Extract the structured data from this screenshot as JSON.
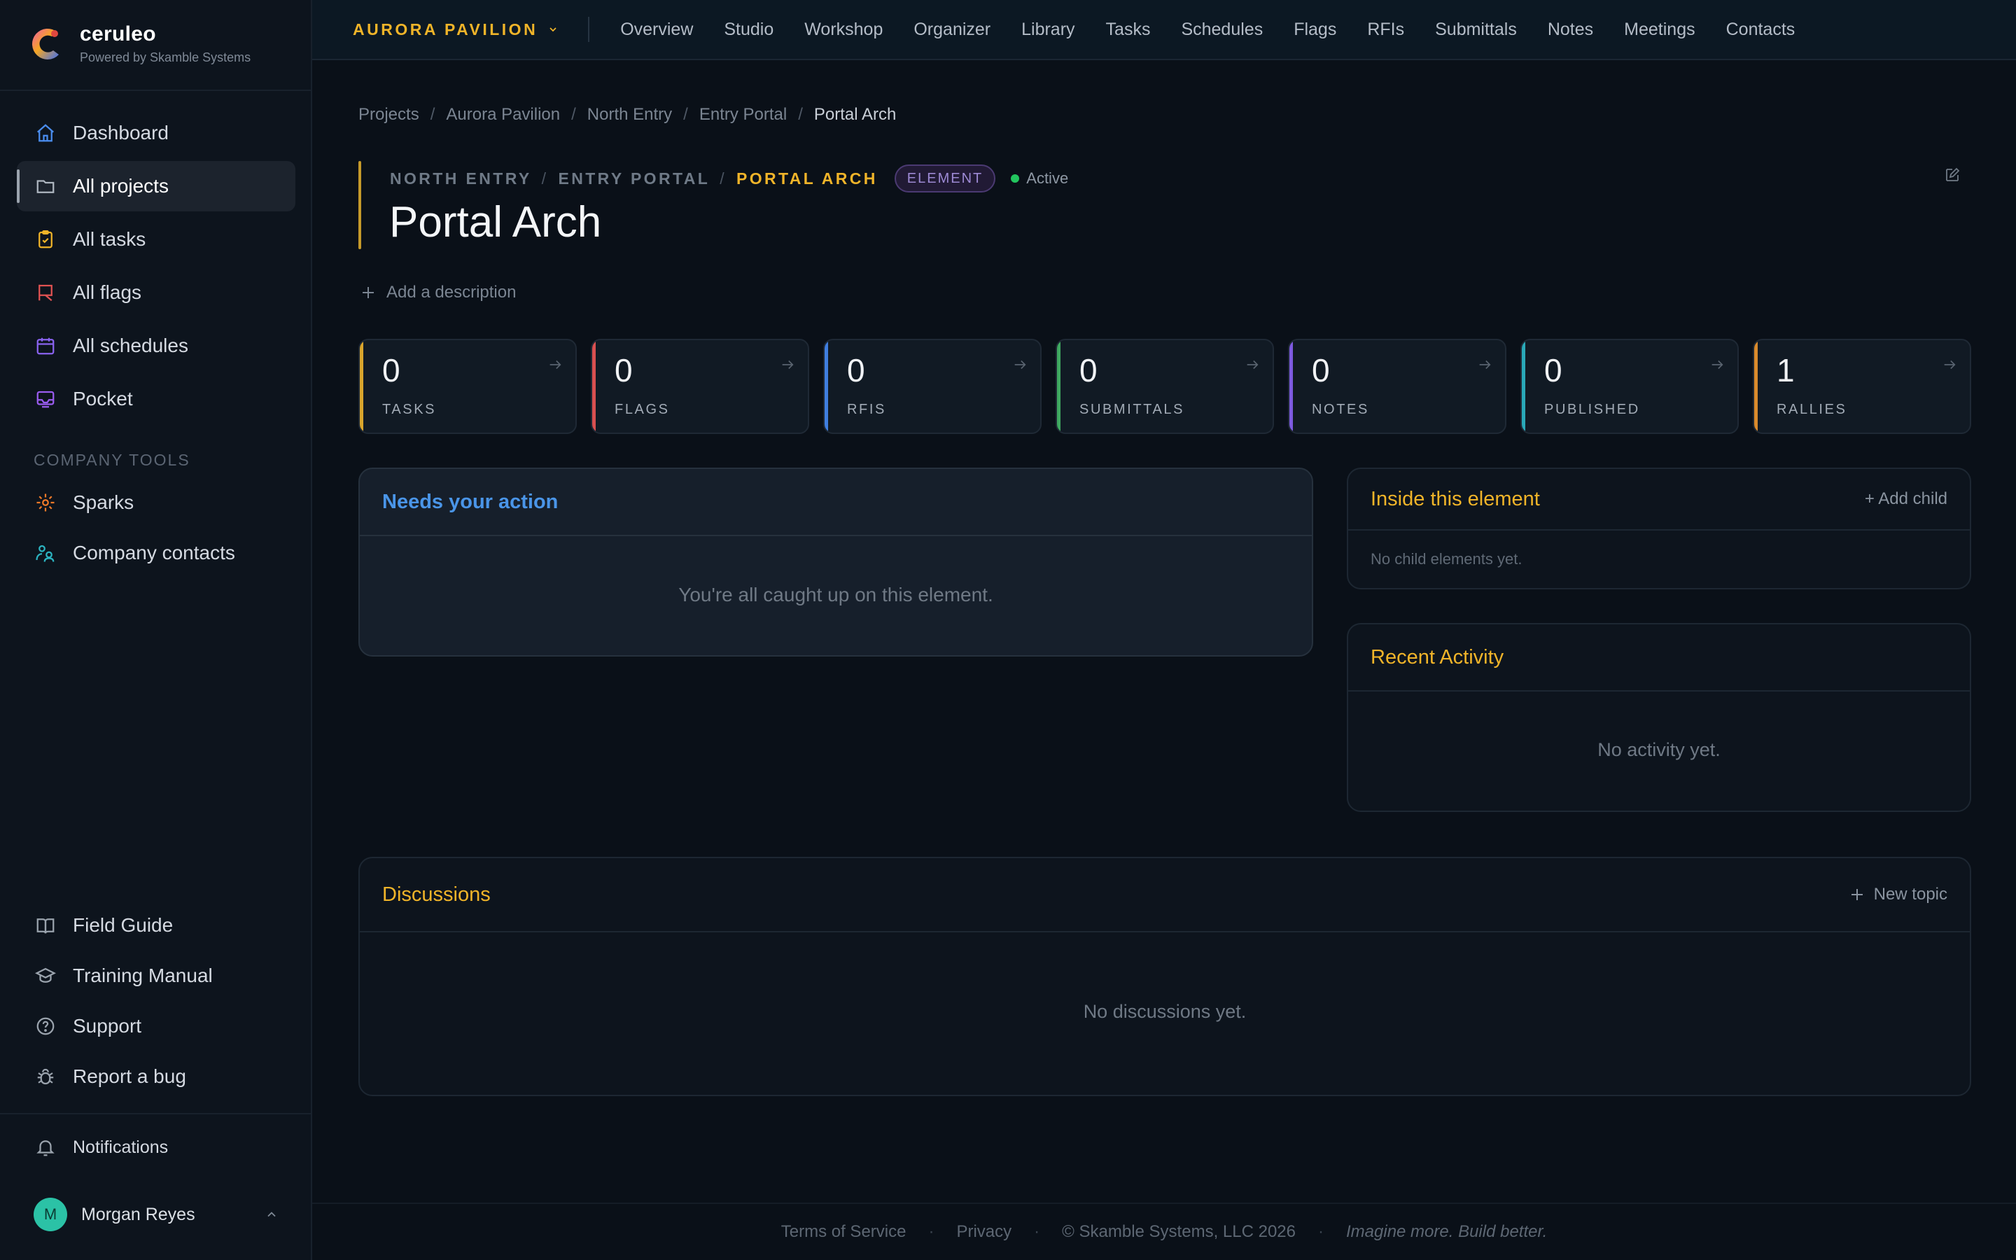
{
  "brand": {
    "name": "ceruleo",
    "subtitle": "Powered by Skamble Systems"
  },
  "sidebar": {
    "nav": [
      {
        "label": "Dashboard",
        "icon": "home-icon",
        "color": "#4a8df0"
      },
      {
        "label": "All projects",
        "icon": "folder-icon",
        "color": "#aeb6c0",
        "active": true
      },
      {
        "label": "All tasks",
        "icon": "clipboard-check-icon",
        "color": "#f0b429"
      },
      {
        "label": "All flags",
        "icon": "flag-icon",
        "color": "#e05252"
      },
      {
        "label": "All schedules",
        "icon": "calendar-icon",
        "color": "#8a63f0"
      },
      {
        "label": "Pocket",
        "icon": "inbox-icon",
        "color": "#9a5cf0"
      }
    ],
    "section_label": "COMPANY TOOLS",
    "tools": [
      {
        "label": "Sparks",
        "icon": "sparks-icon",
        "color": "#f07a29"
      },
      {
        "label": "Company contacts",
        "icon": "contacts-icon",
        "color": "#2bb3c0"
      }
    ],
    "footer_links": [
      {
        "label": "Field Guide",
        "icon": "book-icon"
      },
      {
        "label": "Training Manual",
        "icon": "graduation-cap-icon"
      },
      {
        "label": "Support",
        "icon": "support-icon"
      },
      {
        "label": "Report a bug",
        "icon": "bug-icon"
      }
    ],
    "notifications_label": "Notifications",
    "user": {
      "name": "Morgan Reyes",
      "initial": "M"
    }
  },
  "topbar": {
    "project": "AURORA PAVILION",
    "links": [
      "Overview",
      "Studio",
      "Workshop",
      "Organizer",
      "Library",
      "Tasks",
      "Schedules",
      "Flags",
      "RFIs",
      "Submittals",
      "Notes",
      "Meetings",
      "Contacts"
    ]
  },
  "breadcrumb": [
    "Projects",
    "Aurora Pavilion",
    "North Entry",
    "Entry Portal",
    "Portal Arch"
  ],
  "header": {
    "path": [
      "NORTH ENTRY",
      "ENTRY PORTAL"
    ],
    "current": "PORTAL ARCH",
    "badge": "ELEMENT",
    "status": "Active",
    "title": "Portal Arch",
    "add_description": "Add a description"
  },
  "stats": [
    {
      "value": "0",
      "label": "TASKS",
      "color": "#d9a52c"
    },
    {
      "value": "0",
      "label": "FLAGS",
      "color": "#d95050"
    },
    {
      "value": "0",
      "label": "RFIS",
      "color": "#3f7ee0"
    },
    {
      "value": "0",
      "label": "SUBMITTALS",
      "color": "#3fa860"
    },
    {
      "value": "0",
      "label": "NOTES",
      "color": "#7e5ae0"
    },
    {
      "value": "0",
      "label": "PUBLISHED",
      "color": "#2aa9b8"
    },
    {
      "value": "1",
      "label": "RALLIES",
      "color": "#d98a2c"
    }
  ],
  "needs_action": {
    "title": "Needs your action",
    "empty": "You're all caught up on this element."
  },
  "inside": {
    "title": "Inside this element",
    "action": "+ Add child",
    "empty": "No child elements yet."
  },
  "activity": {
    "title": "Recent Activity",
    "empty": "No activity yet."
  },
  "discussions": {
    "title": "Discussions",
    "action": "New topic",
    "empty": "No discussions yet."
  },
  "footer": {
    "links": [
      "Terms of Service",
      "Privacy"
    ],
    "copyright": "© Skamble Systems, LLC 2026",
    "tagline": "Imagine more. Build better."
  }
}
